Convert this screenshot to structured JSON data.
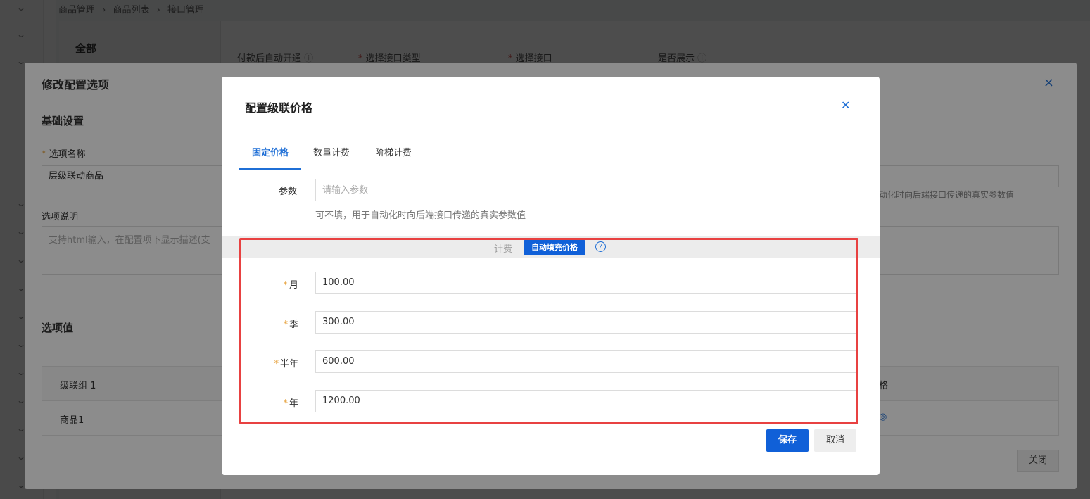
{
  "background": {
    "breadcrumb": [
      "商品管理",
      "›",
      "商品列表",
      "›",
      "接口管理"
    ],
    "side_all": "全部",
    "filters": {
      "auto_open": "付款后自动开通",
      "interface_type": "选择接口类型",
      "interface": "选择接口",
      "show": "是否展示"
    }
  },
  "middle_dialog": {
    "title": "修改配置选项",
    "section_basic": "基础设置",
    "name_label": "选项名称",
    "name_value": "层级联动商品",
    "hint_right": "动化时向后端接口传递的真实参数值",
    "desc_label": "选项说明",
    "desc_placeholder": "支持html输入，在配置项下显示描述(支",
    "section_values": "选项值",
    "table_header": "级联组 1",
    "table_header_right": "格",
    "table_row": "商品1",
    "close_button": "关闭"
  },
  "top_dialog": {
    "title": "配置级联价格",
    "tabs": [
      "固定价格",
      "数量计费",
      "阶梯计费"
    ],
    "param_label": "参数",
    "param_placeholder": "请输入参数",
    "param_hint": "可不填，用于自动化时向后端接口传递的真实参数值",
    "billing_label": "计费",
    "autofill_label": "自动填充价格",
    "prices": [
      {
        "label": "月",
        "value": "100.00"
      },
      {
        "label": "季",
        "value": "300.00"
      },
      {
        "label": "半年",
        "value": "600.00"
      },
      {
        "label": "年",
        "value": "1200.00"
      }
    ],
    "save_label": "保存",
    "cancel_label": "取消"
  },
  "colors": {
    "accent": "#1060d8",
    "required": "#e6a23c",
    "highlight": "#e84141"
  }
}
